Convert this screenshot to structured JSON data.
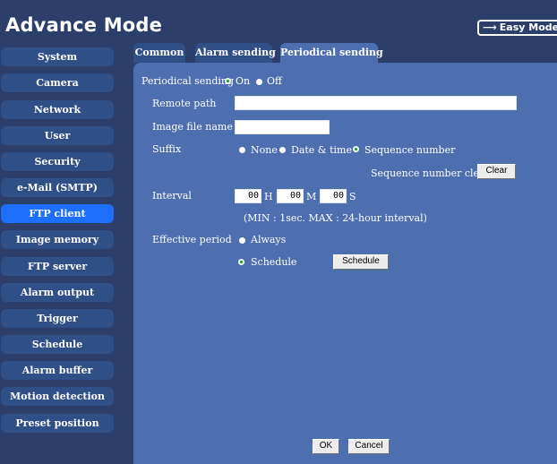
{
  "header": {
    "title": "Advance Mode",
    "easy_mode_icon": "right-arrow-icon",
    "easy_mode_label": "Easy Mode"
  },
  "sidebar": {
    "items": [
      {
        "label": "System"
      },
      {
        "label": "Camera"
      },
      {
        "label": "Network"
      },
      {
        "label": "User"
      },
      {
        "label": "Security"
      },
      {
        "label": "e-Mail (SMTP)"
      },
      {
        "label": "FTP client"
      },
      {
        "label": "Image memory"
      },
      {
        "label": "FTP server"
      },
      {
        "label": "Alarm output"
      },
      {
        "label": "Trigger"
      },
      {
        "label": "Schedule"
      },
      {
        "label": "Alarm buffer"
      },
      {
        "label": "Motion detection"
      },
      {
        "label": "Preset position"
      }
    ],
    "active": "FTP client"
  },
  "tabs": [
    {
      "label": "Common"
    },
    {
      "label": "Alarm sending"
    },
    {
      "label": "Periodical sending"
    }
  ],
  "active_tab": "Periodical sending",
  "form": {
    "periodical_sending": {
      "label": "Periodical sending",
      "on_label": "On",
      "off_label": "Off",
      "value": "On"
    },
    "remote_path": {
      "label": "Remote path",
      "value": ""
    },
    "image_file_name": {
      "label": "Image file name",
      "value": ""
    },
    "suffix": {
      "label": "Suffix",
      "options": [
        "None",
        "Date & time",
        "Sequence number"
      ],
      "value": "Sequence number"
    },
    "sequence_clear": {
      "label": "Sequence number clear",
      "button": "Clear"
    },
    "interval": {
      "label": "Interval",
      "hours": "00",
      "h_unit": "H",
      "minutes": "00",
      "m_unit": "M",
      "seconds": "00",
      "s_unit": "S",
      "note": "(MIN : 1sec. MAX : 24-hour interval)"
    },
    "effective_period": {
      "label": "Effective period",
      "always_label": "Always",
      "schedule_label": "Schedule",
      "value": "Schedule",
      "schedule_button": "Schedule"
    }
  },
  "footer": {
    "ok_label": "OK",
    "cancel_label": "Cancel"
  },
  "colors": {
    "background": "#2c3f6b",
    "panel": "#4d6fb0",
    "nav_item": "#2f4f87",
    "nav_active": "#1f6fff"
  }
}
